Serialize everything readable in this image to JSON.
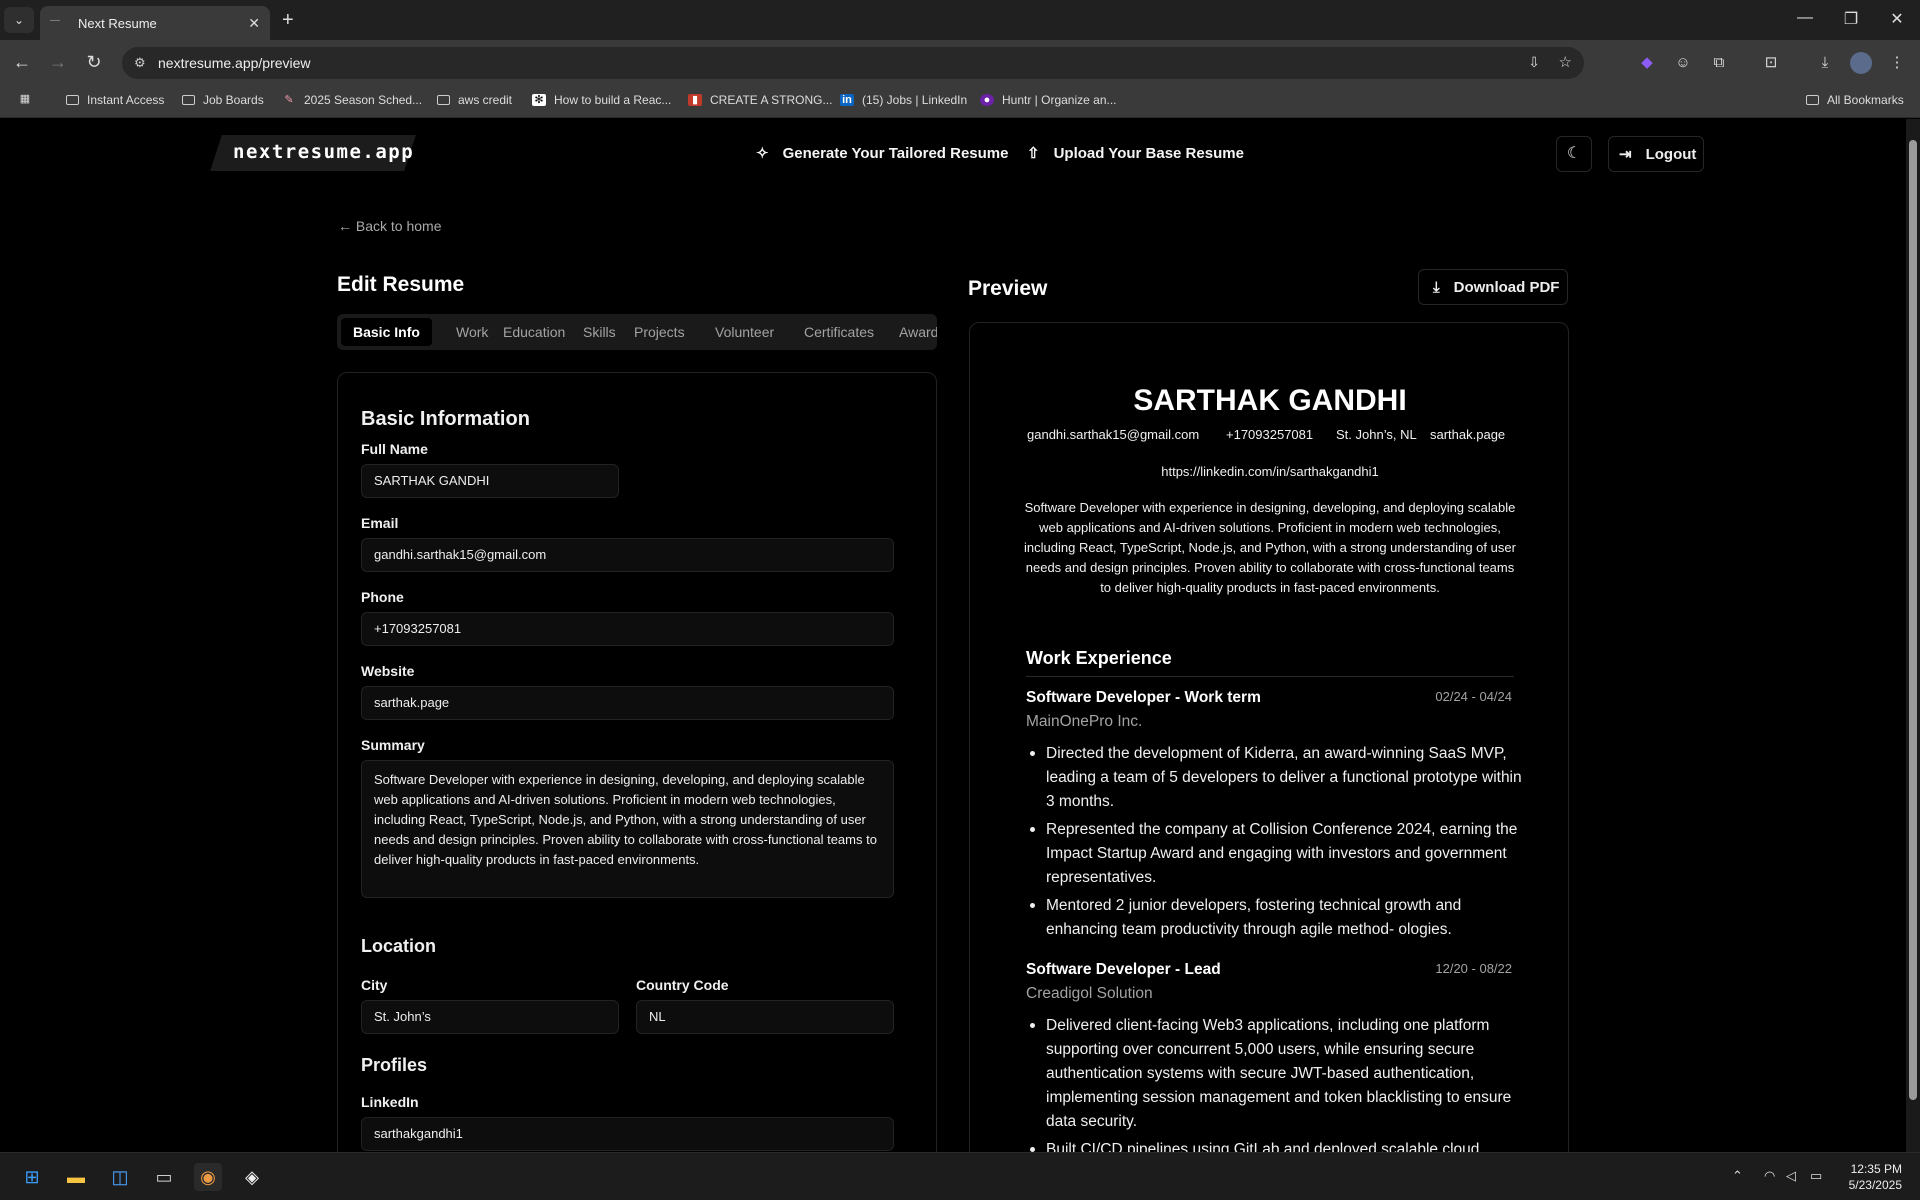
{
  "browser": {
    "tab_title": "Next Resume",
    "url": "nextresume.app/preview",
    "bookmarks": [
      "Instant Access",
      "Job Boards",
      "2025 Season Sched...",
      "aws credit",
      "How to build a Reac...",
      "CREATE A STRONG...",
      "(15) Jobs | LinkedIn",
      "Huntr | Organize an..."
    ],
    "all_bookmarks": "All Bookmarks"
  },
  "header": {
    "logo": "nextresume.app",
    "generate": "Generate Your Tailored Resume",
    "upload": "Upload Your Base Resume",
    "logout": "Logout"
  },
  "page": {
    "back": "Back to home",
    "edit_title": "Edit Resume",
    "preview_title": "Preview",
    "download": "Download PDF"
  },
  "tabs": [
    "Basic Info",
    "Work",
    "Education",
    "Skills",
    "Projects",
    "Volunteer",
    "Certificates",
    "Awards"
  ],
  "form": {
    "section_basic": "Basic Information",
    "full_name_label": "Full Name",
    "full_name": "SARTHAK GANDHI",
    "email_label": "Email",
    "email": "gandhi.sarthak15@gmail.com",
    "phone_label": "Phone",
    "phone": "+17093257081",
    "website_label": "Website",
    "website": "sarthak.page",
    "summary_label": "Summary",
    "summary": "Software Developer with experience in designing, developing, and deploying scalable web applications and AI-driven solutions. Proficient in modern web technologies, including React, TypeScript, Node.js, and Python, with a strong understanding of user needs and design principles. Proven ability to collaborate with cross-functional teams to deliver high-quality products in fast-paced environments.",
    "section_location": "Location",
    "city_label": "City",
    "city": "St. John’s",
    "country_label": "Country Code",
    "country": "NL",
    "section_profiles": "Profiles",
    "linkedin_label": "LinkedIn",
    "linkedin": "sarthakgandhi1"
  },
  "preview": {
    "name": "SARTHAK GANDHI",
    "email": "gandhi.sarthak15@gmail.com",
    "phone": "+17093257081",
    "location": "St. John’s, NL",
    "website": "sarthak.page",
    "linkedin_url": "https://linkedin.com/in/sarthakgandhi1",
    "summary": "Software Developer with experience in designing, developing, and deploying scalable web applications and AI-driven solutions. Proficient in modern web technologies, including React, TypeScript, Node.js, and Python, with a strong understanding of user needs and design principles. Proven ability to collaborate with cross-functional teams to deliver high-quality products in fast-paced environments.",
    "work_title": "Work Experience",
    "jobs": [
      {
        "title": "Software Developer - Work term",
        "company": "MainOnePro Inc.",
        "dates": "02/24 - 04/24",
        "bullets": [
          "Directed the development of Kiderra, an award-winning SaaS MVP, leading a team of 5 developers to deliver a functional prototype within 3 months.",
          "Represented the company at Collision Conference 2024, earning the Impact Startup Award and engaging with investors and government representatives.",
          "Mentored 2 junior developers, fostering technical growth and enhancing team productivity through agile method- ologies."
        ]
      },
      {
        "title": "Software Developer - Lead",
        "company": "Creadigol Solution",
        "dates": "12/20 - 08/22",
        "bullets": [
          "Delivered client-facing Web3 applications, including one platform supporting over concurrent 5,000 users, while ensuring secure authentication systems with secure JWT-based authentication, implementing session management and token blacklisting to ensure data security.",
          "Built CI/CD pipelines using GitLab and deployed scalable cloud"
        ]
      }
    ]
  },
  "taskbar": {
    "time": "12:35 PM",
    "date": "5/23/2025"
  }
}
